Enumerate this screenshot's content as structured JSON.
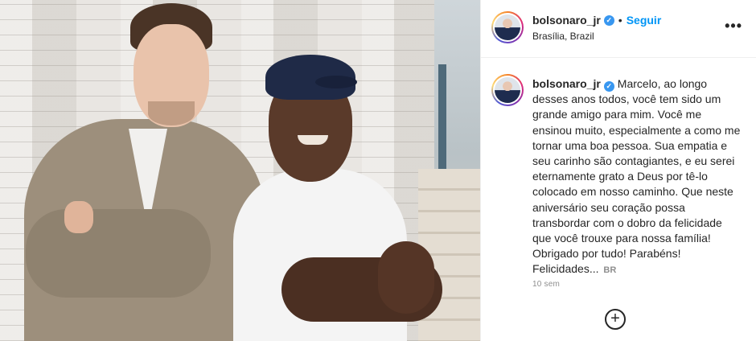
{
  "post": {
    "header": {
      "username": "bolsonaro_jr",
      "verified_mark": "✓",
      "separator": "•",
      "follow_label": "Seguir",
      "location": "Brasília, Brazil",
      "more_label": "•••"
    },
    "caption": {
      "username": "bolsonaro_jr",
      "text": "Marcelo, ao longo desses anos todos, você tem sido um grande amigo para mim. Você me ensinou muito, especialmente a como me tornar uma boa pessoa. Sua empatia e seu carinho são contagiantes, e eu serei eternamente grato a Deus por tê-lo colocado em nosso caminho. Que neste aniversário seu coração possa transbordar com o dobro da felicidade que você trouxe para nossa família! Obrigado por tudo! Parabéns! Felicidades...",
      "more_link": "BR"
    },
    "timestamp": "10 sem",
    "add_comment_icon": "+"
  },
  "colors": {
    "accent": "#0095f6",
    "verified": "#3897f0",
    "text": "#262626",
    "muted": "#8e8e8e"
  },
  "icons": {
    "verified": "verified-badge-icon",
    "more": "more-options-icon",
    "add_comment": "plus-circle-icon"
  }
}
